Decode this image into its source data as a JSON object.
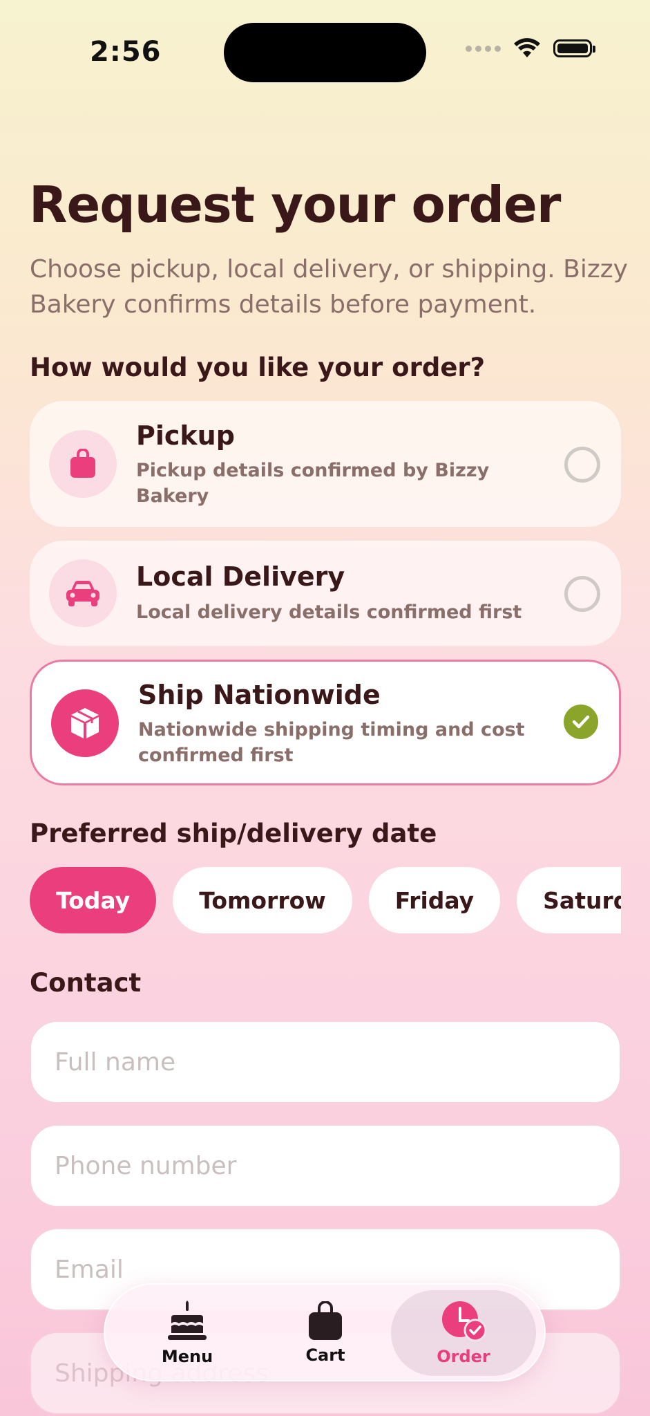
{
  "status": {
    "time": "2:56"
  },
  "header": {
    "title": "Request your order",
    "subtitle": "Choose pickup, local delivery, or shipping. Bizzy Bakery confirms details before payment."
  },
  "fulfillment": {
    "heading": "How would you like your order?",
    "options": [
      {
        "title": "Pickup",
        "description": "Pickup details confirmed by Bizzy Bakery",
        "icon": "shopping-bag-icon",
        "selected": false
      },
      {
        "title": "Local Delivery",
        "description": "Local delivery details confirmed first",
        "icon": "car-icon",
        "selected": false
      },
      {
        "title": "Ship Nationwide",
        "description": "Nationwide shipping timing and cost confirmed first",
        "icon": "package-icon",
        "selected": true
      }
    ]
  },
  "date": {
    "heading": "Preferred ship/delivery date",
    "chips": [
      "Today",
      "Tomorrow",
      "Friday",
      "Saturday"
    ],
    "selected": "Today"
  },
  "contact": {
    "heading": "Contact",
    "name_placeholder": "Full name",
    "phone_placeholder": "Phone number",
    "email_placeholder": "Email",
    "shipping_placeholder": "Shipping address"
  },
  "tabs": [
    {
      "label": "Menu",
      "icon": "cake-icon"
    },
    {
      "label": "Cart",
      "icon": "bag-icon"
    },
    {
      "label": "Order",
      "icon": "clock-check-icon",
      "active": true
    }
  ],
  "colors": {
    "accent": "#eb3e7d",
    "check": "#8aa52a",
    "text": "#3a1718",
    "muted": "#8a6e69"
  }
}
